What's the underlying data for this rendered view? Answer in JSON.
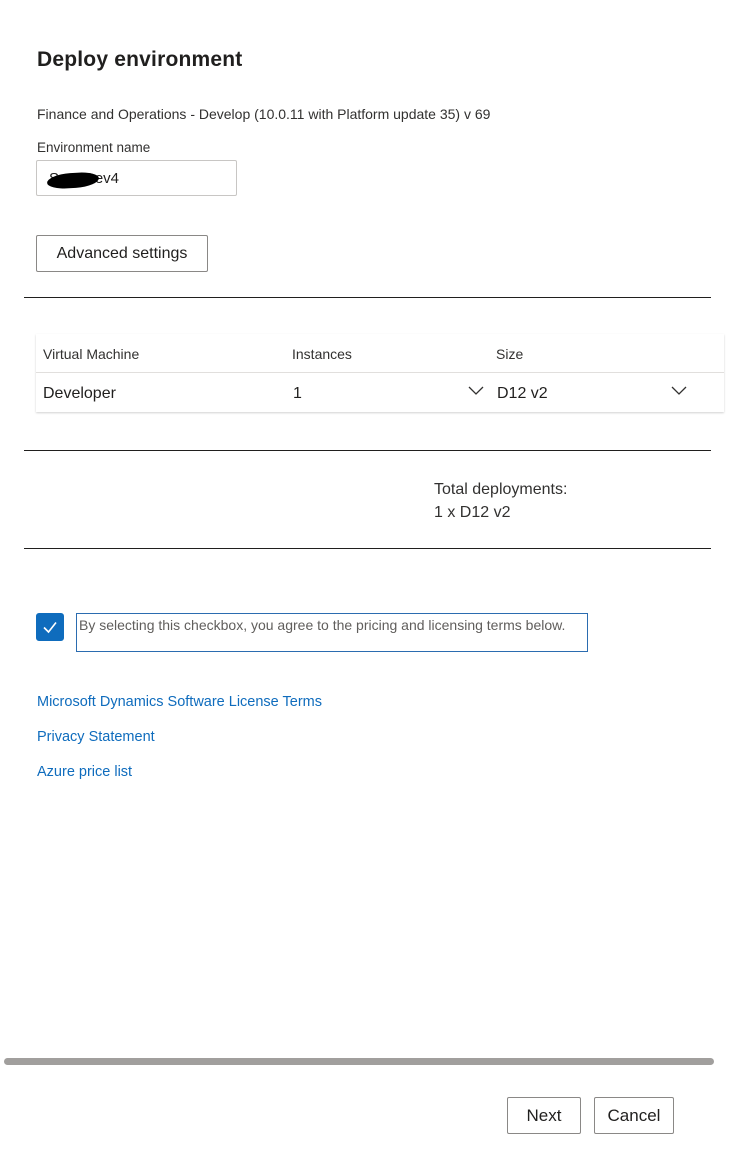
{
  "panel": {
    "title": "Deploy environment",
    "subtitle": "Finance and Operations - Develop (10.0.11 with Platform update 35) v 69"
  },
  "environment_name": {
    "label": "Environment name",
    "value": "S      Dev4"
  },
  "advanced_settings_label": "Advanced settings",
  "table": {
    "columns": [
      "Virtual Machine",
      "Instances",
      "Size"
    ],
    "rows": [
      {
        "virtual_machine": "Developer",
        "instances": "1",
        "size": "D12 v2"
      }
    ]
  },
  "summary": {
    "label": "Total deployments:",
    "value": "1 x D12 v2"
  },
  "terms": {
    "checked": true,
    "text": "By selecting this checkbox, you agree to the pricing and licensing terms below."
  },
  "links": [
    "Microsoft Dynamics Software License Terms",
    "Privacy Statement",
    "Azure price list"
  ],
  "footer": {
    "next_label": "Next",
    "cancel_label": "Cancel"
  },
  "colors": {
    "accent": "#0f6cbd",
    "link": "#0f6cbd",
    "text": "#323130"
  }
}
